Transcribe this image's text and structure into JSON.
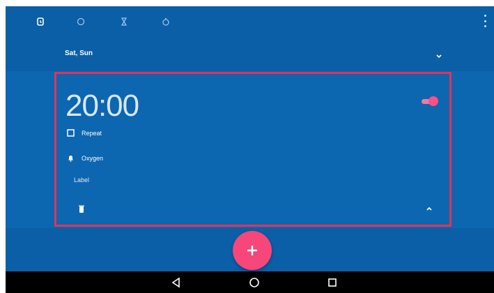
{
  "tabs": [
    {
      "name": "alarm",
      "icon": "alarm-icon"
    },
    {
      "name": "clock",
      "icon": "clock-icon"
    },
    {
      "name": "timer",
      "icon": "timer-icon"
    },
    {
      "name": "stopwatch",
      "icon": "stopwatch-icon"
    }
  ],
  "collapsed_alarm": {
    "days": "Sat, Sun"
  },
  "expanded_alarm": {
    "time": "20:00",
    "enabled": true,
    "repeat_label": "Repeat",
    "ringtone_label": "Oxygen",
    "label_text": "Label"
  },
  "colors": {
    "background": "#0a5fa6",
    "card": "#0d66b0",
    "accent": "#f7467a",
    "highlight": "#e53257"
  },
  "nav": {
    "back": "back-icon",
    "home": "home-icon",
    "recents": "recents-icon"
  }
}
